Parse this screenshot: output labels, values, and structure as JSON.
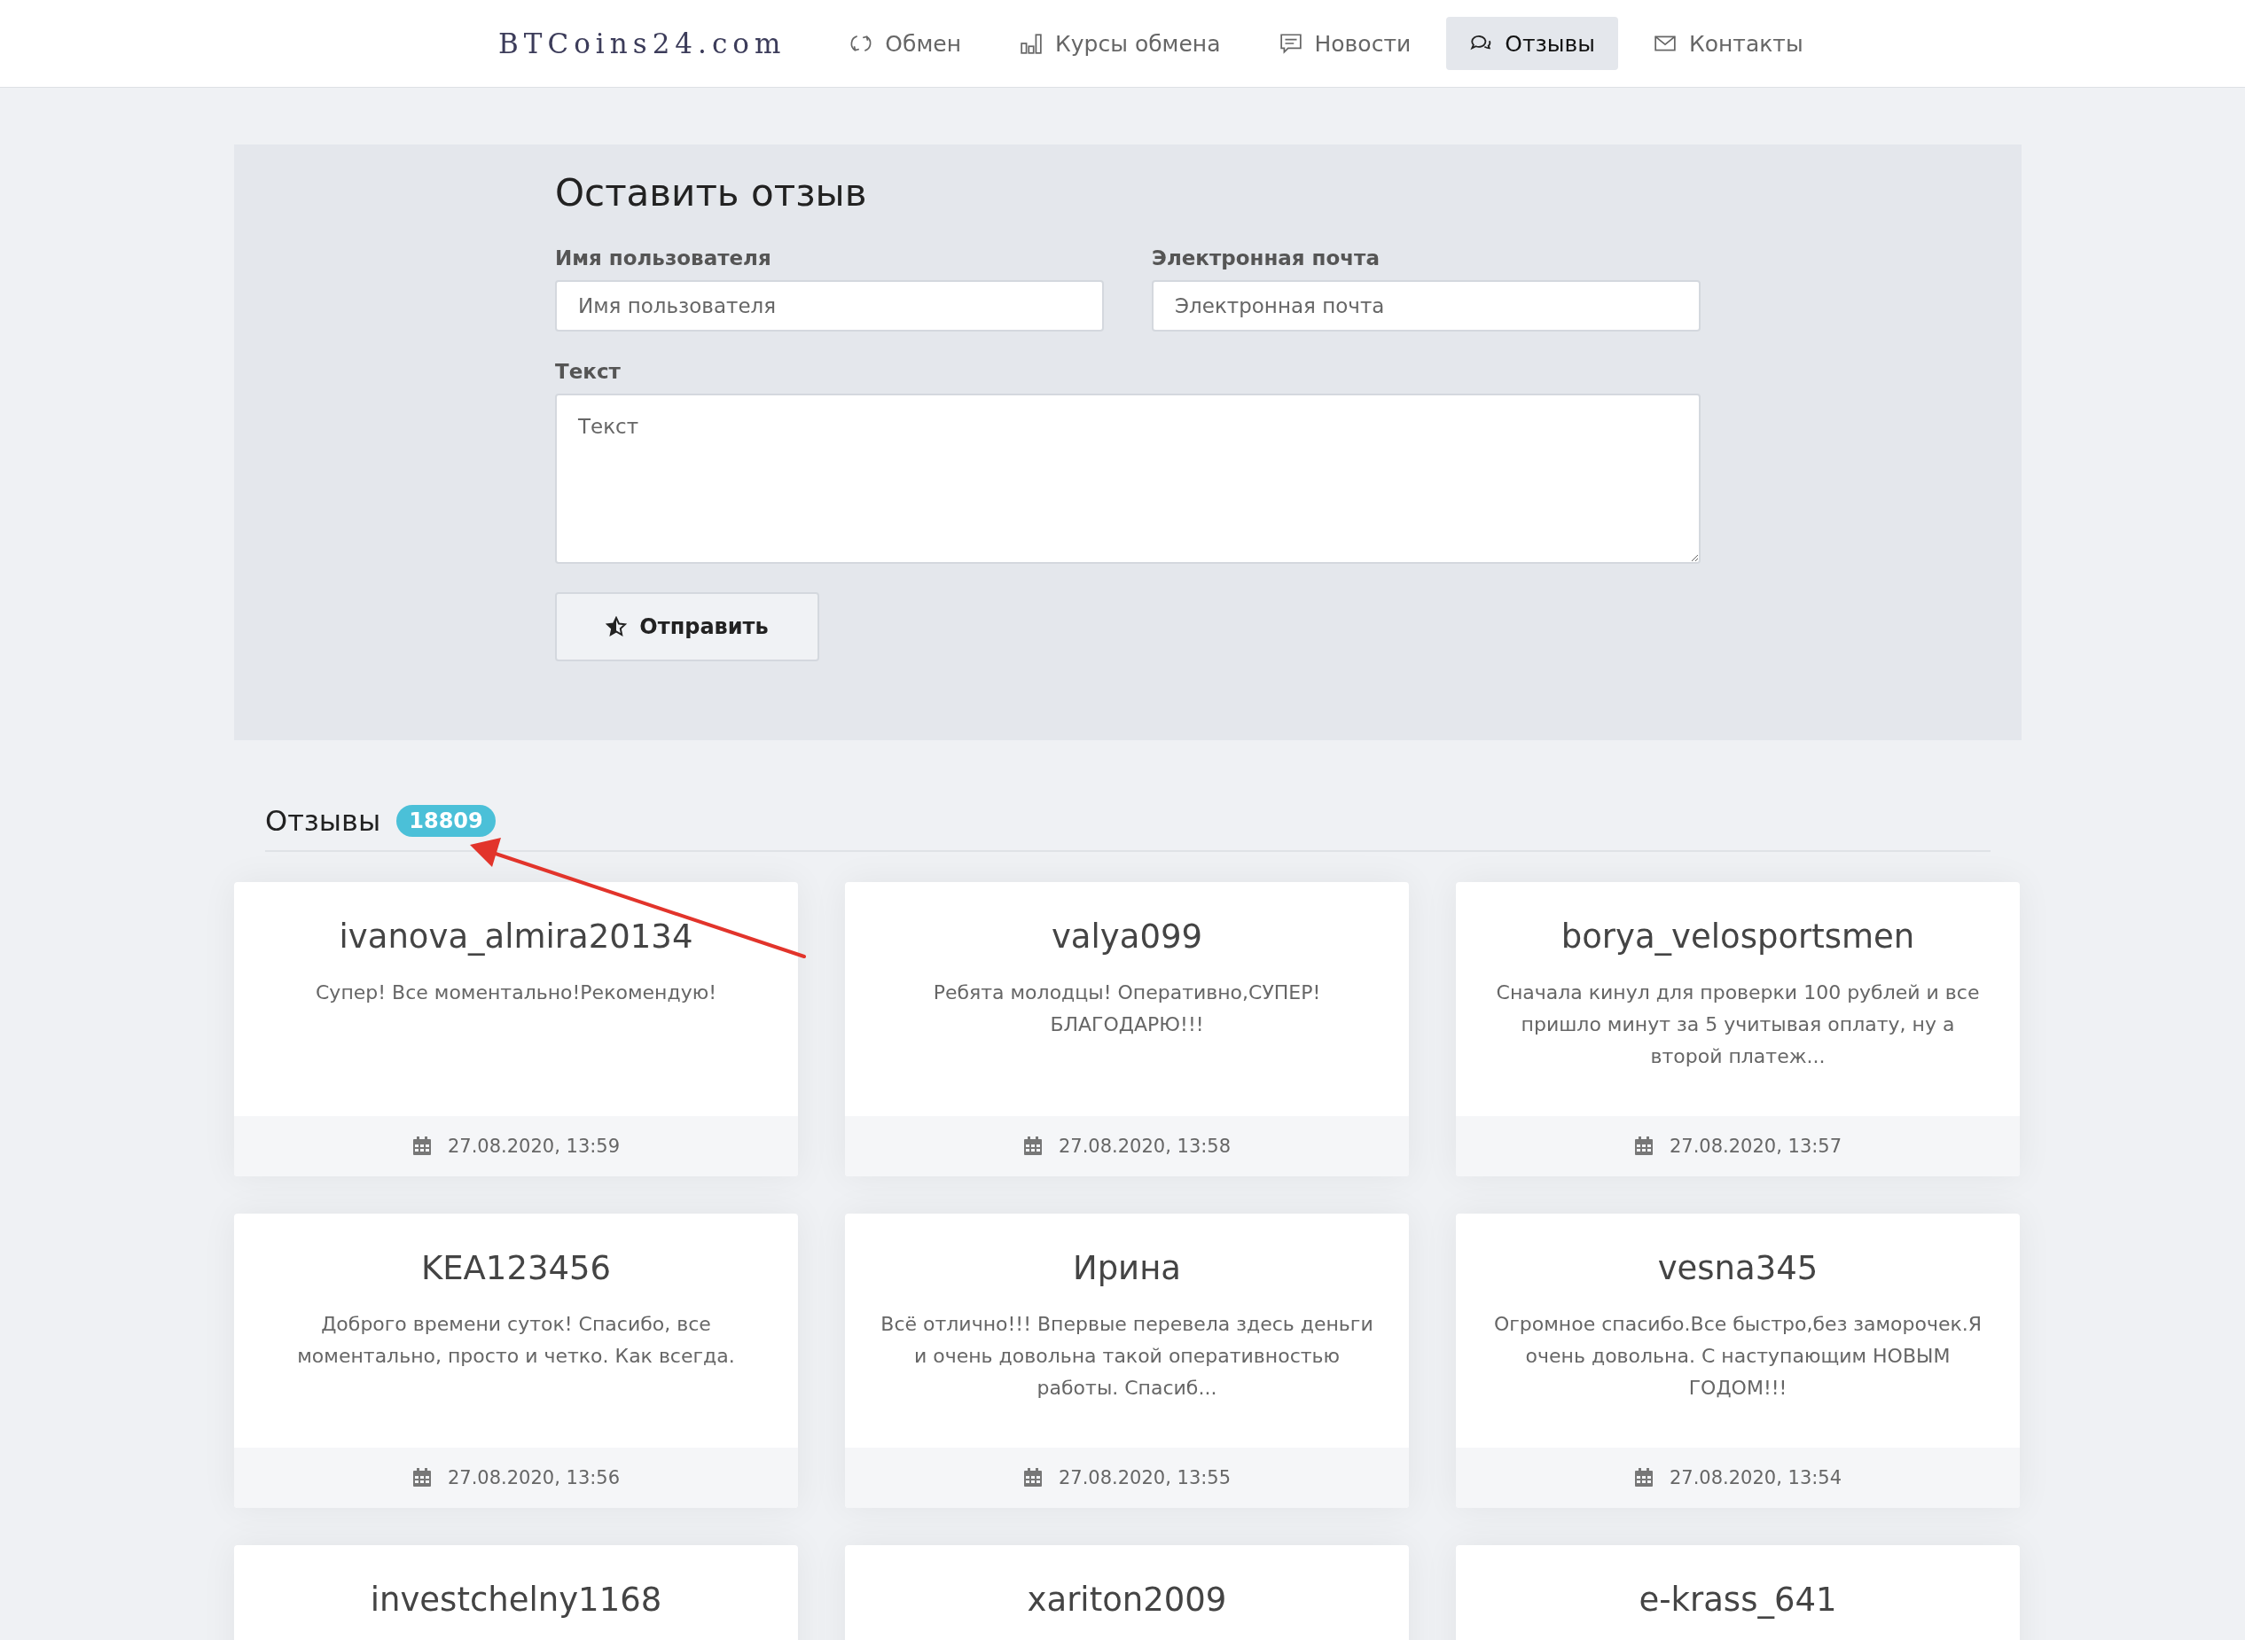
{
  "logo": "BTCoins24.com",
  "nav": [
    {
      "label": "Обмен",
      "selected": false
    },
    {
      "label": "Курсы обмена",
      "selected": false
    },
    {
      "label": "Новости",
      "selected": false
    },
    {
      "label": "Отзывы",
      "selected": true
    },
    {
      "label": "Контакты",
      "selected": false
    }
  ],
  "form": {
    "title": "Оставить отзыв",
    "fields": [
      {
        "label": "Имя пользователя",
        "placeholder": "Имя пользователя"
      },
      {
        "label": "Электронная почта",
        "placeholder": "Электронная почта"
      }
    ],
    "text": {
      "label": "Текст",
      "placeholder": "Текст"
    },
    "submit": "Отправить"
  },
  "reviews": {
    "title": "Отзывы",
    "count": "18809",
    "items": [
      {
        "name": "ivanova_almira20134",
        "text": "Супер! Все моментально!Рекомендую!",
        "date": "27.08.2020, 13:59"
      },
      {
        "name": "valya099",
        "text": "Ребята молодцы! Оперативно,СУПЕР! БЛАГОДАРЮ!!!",
        "date": "27.08.2020, 13:58"
      },
      {
        "name": "borya_velosportsmen",
        "text": "Сначала кинул для проверки 100 рублей и все пришло минут за 5 учитывая оплату, ну а второй платеж...",
        "date": "27.08.2020, 13:57"
      },
      {
        "name": "KEA123456",
        "text": "Доброго времени суток! Спасибо, все моментально, просто и четко. Как всегда.",
        "date": "27.08.2020, 13:56"
      },
      {
        "name": "Ирина",
        "text": "Всё отлично!!! Впервые перевела здесь деньги и очень довольна такой оперативностью работы. Спасиб...",
        "date": "27.08.2020, 13:55"
      },
      {
        "name": "vesna345",
        "text": "Огромное спасибо.Все быстро,без заморочек.Я очень довольна. С наступающим НОВЫМ ГОДОМ!!!",
        "date": "27.08.2020, 13:54"
      },
      {
        "name": "investchelny1168"
      },
      {
        "name": "xariton2009"
      },
      {
        "name": "e-krass_641"
      }
    ]
  }
}
